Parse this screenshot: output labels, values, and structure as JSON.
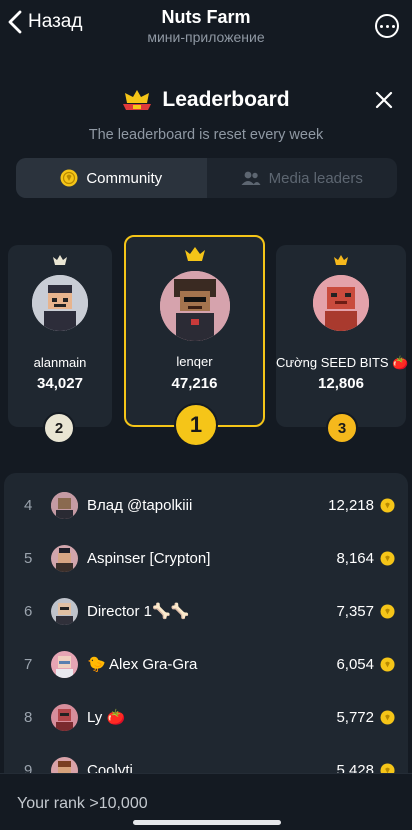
{
  "topbar": {
    "back_label": "Назад",
    "title": "Nuts Farm",
    "subtitle": "мини-приложение"
  },
  "header": {
    "title": "Leaderboard",
    "subtitle": "The leaderboard is reset every week"
  },
  "tabs": [
    {
      "label": "Community",
      "active": true
    },
    {
      "label": "Media leaders",
      "active": false
    }
  ],
  "podium": {
    "first": {
      "rank": "1",
      "name": "lenqer",
      "score": "47,216"
    },
    "second": {
      "rank": "2",
      "name": "alanmain",
      "score": "34,027"
    },
    "third": {
      "rank": "3",
      "name": "Cường SEED BITS 🍅",
      "score": "12,806"
    }
  },
  "leaders": [
    {
      "rank": "4",
      "name": "Влад @tapolkiii",
      "score": "12,218"
    },
    {
      "rank": "5",
      "name": "Aspinser [Crypton]",
      "score": "8,164"
    },
    {
      "rank": "6",
      "name": "Director 1🦴🦴",
      "score": "7,357"
    },
    {
      "rank": "7",
      "name": "🐤 Alex Gra-Gra",
      "score": "6,054"
    },
    {
      "rank": "8",
      "name": "Ly 🍅",
      "score": "5,772"
    },
    {
      "rank": "9",
      "name": "Coolyti",
      "score": "5,428"
    }
  ],
  "footer": {
    "your_rank": "Your rank >10,000"
  },
  "colors": {
    "background": "#141a22",
    "card": "#1f2730",
    "accent_gold": "#f5c518",
    "silver_badge": "#e9e5d3",
    "bronze_badge": "#f5b81c",
    "muted_text": "#8f98a3"
  }
}
